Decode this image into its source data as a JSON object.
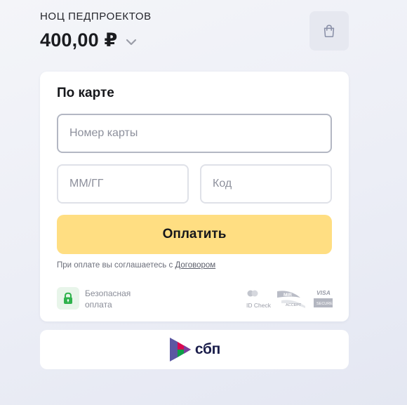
{
  "header": {
    "merchant": "НОЦ ПЕДПРОЕКТОВ",
    "amount": "400,00 ₽",
    "cart_icon": "shopping-bag-icon",
    "chevron_icon": "chevron-down-icon"
  },
  "card_form": {
    "title": "По карте",
    "card_number": {
      "placeholder": "Номер карты",
      "value": ""
    },
    "expiry": {
      "placeholder": "ММ/ГГ",
      "value": ""
    },
    "cvc": {
      "placeholder": "Код",
      "value": ""
    },
    "pay_label": "Оплатить",
    "agreement_text": "При оплате вы соглашаетесь с ",
    "agreement_link": "Договором",
    "secure_line1": "Безопасная",
    "secure_line2": "оплата",
    "secure_icon": "lock-icon",
    "payment_logos": {
      "mastercard_caption": "ID Check",
      "mir": "MIR",
      "mir_caption": "ACCEPT",
      "visa": "VISA",
      "visa_caption": "SECURE"
    }
  },
  "sbp": {
    "label": "сбп",
    "logo_icon": "sbp-logo-icon"
  },
  "colors": {
    "accent": "#ffde82",
    "lock_green": "#2fb24c",
    "sbp_text": "#1b1e4b"
  }
}
